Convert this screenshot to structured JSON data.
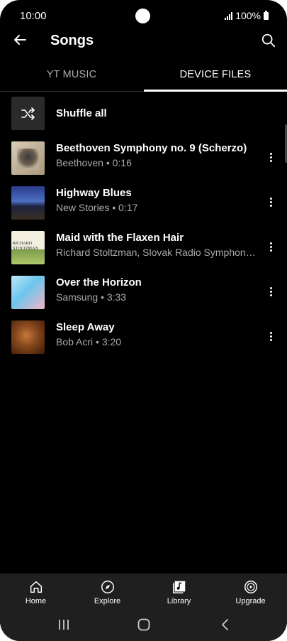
{
  "status_bar": {
    "time": "10:00",
    "battery": "100%"
  },
  "header": {
    "title": "Songs"
  },
  "tabs": [
    {
      "label": "YT MUSIC",
      "selected": false
    },
    {
      "label": "DEVICE FILES",
      "selected": true
    }
  ],
  "shuffle": {
    "label": "Shuffle all"
  },
  "songs": [
    {
      "title": "Beethoven Symphony no. 9 (Scherzo)",
      "subtitle": "Beethoven • 0:16"
    },
    {
      "title": "Highway Blues",
      "subtitle": "New Stories • 0:17"
    },
    {
      "title": "Maid with the Flaxen Hair",
      "subtitle": "Richard Stoltzman, Slovak Radio Symphony Orchestra"
    },
    {
      "title": "Over the Horizon",
      "subtitle": "Samsung • 3:33"
    },
    {
      "title": "Sleep Away",
      "subtitle": "Bob Acri • 3:20"
    }
  ],
  "album_art_text": {
    "maid": "RICHARD STOLTZMAN"
  },
  "bottom_nav": [
    {
      "label": "Home",
      "icon": "home-icon"
    },
    {
      "label": "Explore",
      "icon": "compass-icon"
    },
    {
      "label": "Library",
      "icon": "library-icon"
    },
    {
      "label": "Upgrade",
      "icon": "upgrade-icon"
    }
  ],
  "system_nav": [
    "recents-icon",
    "home-button-icon",
    "back-icon"
  ]
}
